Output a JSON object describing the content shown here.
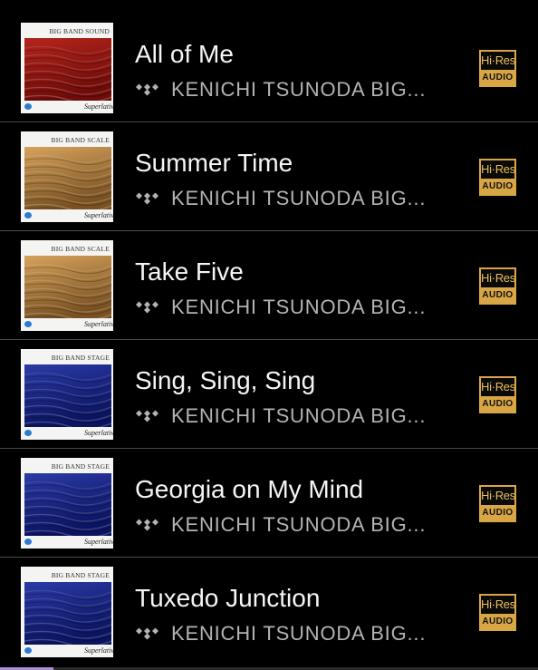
{
  "tracks": [
    {
      "title": "All of Me",
      "artist": "KENICHI TSUNODA BIG...",
      "album_text": "BIG BAND SOUND",
      "album_label": "Superlative",
      "art_color_top": "#b5241d",
      "art_color_bottom": "#6e0c08",
      "badge_top": "Hi·Res",
      "badge_bottom": "AUDIO"
    },
    {
      "title": "Summer Time",
      "artist": "KENICHI TSUNODA BIG...",
      "album_text": "BIG BAND SCALE",
      "album_label": "Superlative",
      "art_color_top": "#d6a25c",
      "art_color_bottom": "#7a5222",
      "badge_top": "Hi·Res",
      "badge_bottom": "AUDIO"
    },
    {
      "title": "Take Five",
      "artist": "KENICHI TSUNODA BIG...",
      "album_text": "BIG BAND SCALE",
      "album_label": "Superlative",
      "art_color_top": "#d6a25c",
      "art_color_bottom": "#7a5222",
      "badge_top": "Hi·Res",
      "badge_bottom": "AUDIO"
    },
    {
      "title": "Sing, Sing, Sing",
      "artist": "KENICHI TSUNODA BIG...",
      "album_text": "BIG BAND STAGE",
      "album_label": "Superlative",
      "art_color_top": "#2b3aa6",
      "art_color_bottom": "#0b1460",
      "badge_top": "Hi·Res",
      "badge_bottom": "AUDIO"
    },
    {
      "title": "Georgia on My Mind",
      "artist": "KENICHI TSUNODA BIG...",
      "album_text": "BIG BAND STAGE",
      "album_label": "Superlative",
      "art_color_top": "#2b3aa6",
      "art_color_bottom": "#0b1460",
      "badge_top": "Hi·Res",
      "badge_bottom": "AUDIO"
    },
    {
      "title": "Tuxedo Junction",
      "artist": "KENICHI TSUNODA BIG...",
      "album_text": "BIG BAND STAGE",
      "album_label": "Superlative",
      "art_color_top": "#2b3aa6",
      "art_color_bottom": "#0b1460",
      "badge_top": "Hi·Res",
      "badge_bottom": "AUDIO"
    }
  ],
  "source_icon": "tidal-icon",
  "colors": {
    "background": "#000000",
    "title_text": "#f5f5f5",
    "artist_text": "#b3b3b3",
    "hires_gold": "#d8a645",
    "divider": "#4a4a4a",
    "progress": "#a98ed6"
  },
  "progress_fraction": 0.1
}
